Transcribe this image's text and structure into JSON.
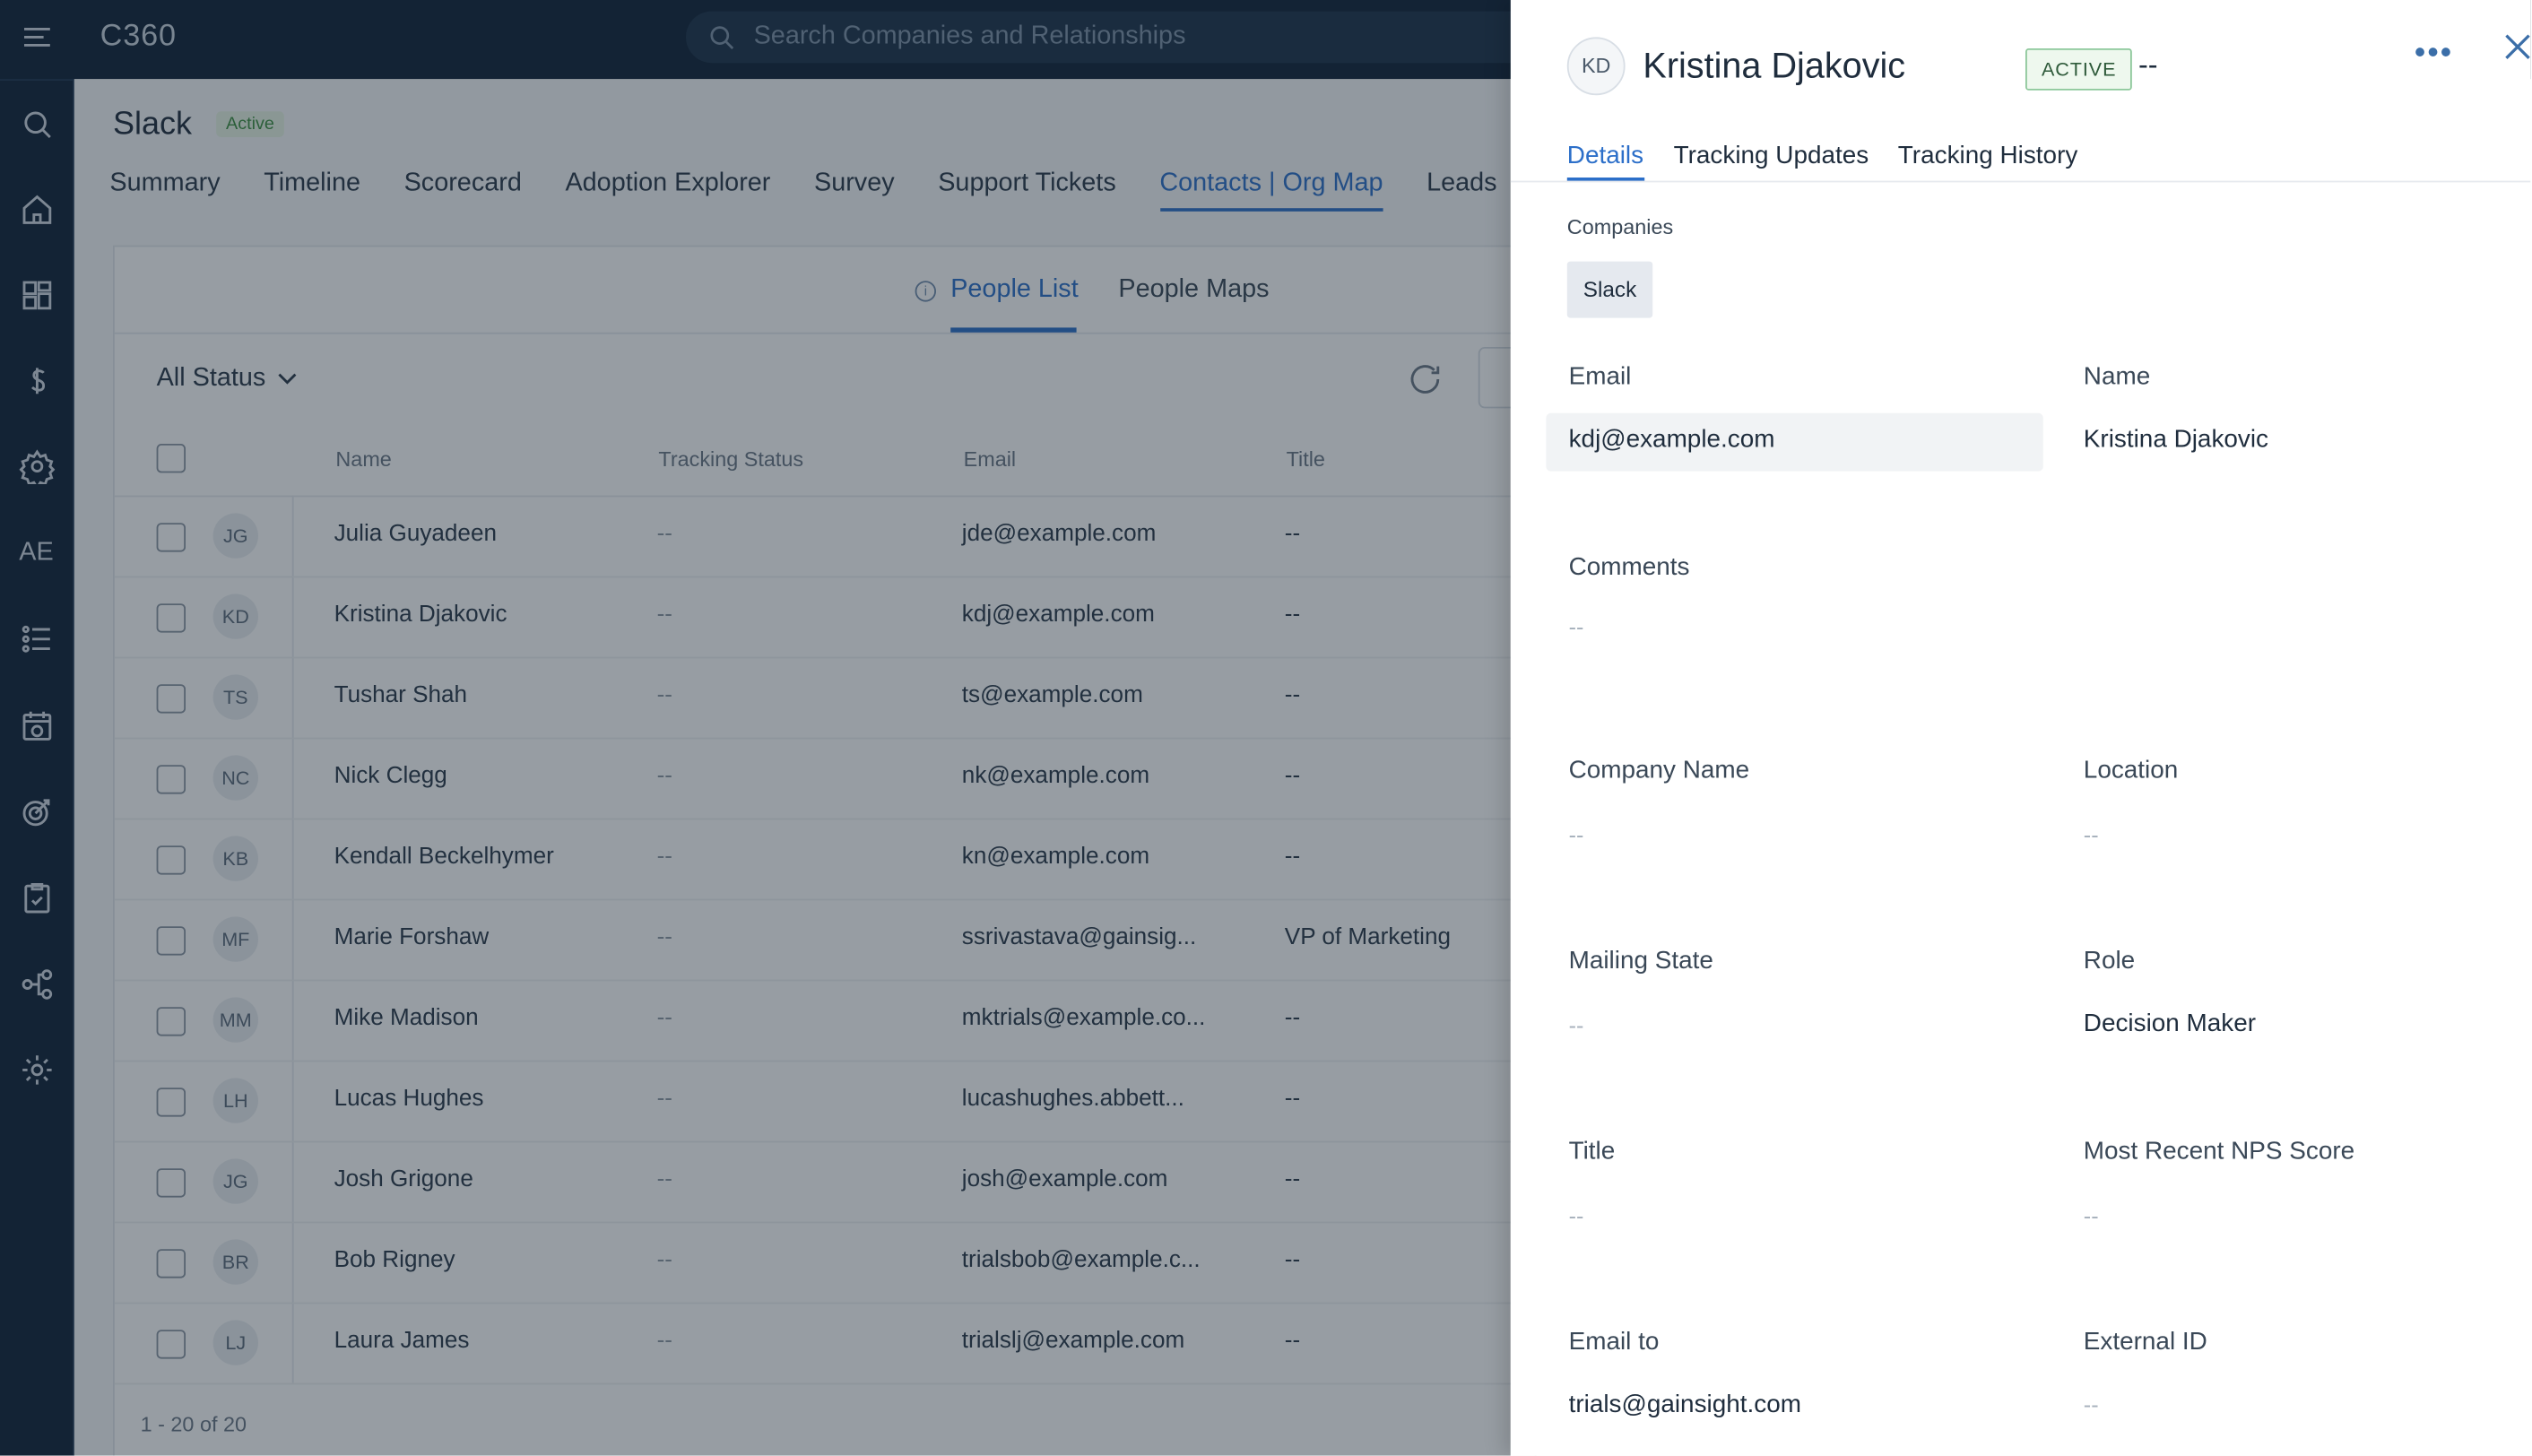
{
  "app": {
    "brand": "C360",
    "search_placeholder": "Search Companies and Relationships"
  },
  "rail": {
    "icons": [
      "menu-icon",
      "search-icon",
      "home-icon",
      "dashboard-icon",
      "dollar-icon",
      "gear-badge-icon",
      "ae-icon",
      "timeline-list-icon",
      "calendar-clock-icon",
      "target-icon",
      "clipboard-check-icon",
      "hierarchy-icon",
      "settings-icon"
    ],
    "ae_label": "AE"
  },
  "account": {
    "name": "Slack",
    "status": "Active"
  },
  "tabs": [
    "Summary",
    "Timeline",
    "Scorecard",
    "Adoption Explorer",
    "Survey",
    "Support Tickets",
    "Contacts | Org Map",
    "Leads"
  ],
  "active_tab": "Contacts | Org Map",
  "subtabs": {
    "people_list": "People List",
    "people_maps": "People Maps"
  },
  "filter": {
    "status": "All Status"
  },
  "table": {
    "headers": {
      "name": "Name",
      "tracking": "Tracking Status",
      "email": "Email",
      "title": "Title"
    },
    "rows": [
      {
        "initials": "JG",
        "name": "Julia Guyadeen",
        "tracking": "--",
        "email": "jde@example.com",
        "title": "--"
      },
      {
        "initials": "KD",
        "name": "Kristina Djakovic",
        "tracking": "--",
        "email": "kdj@example.com",
        "title": "--"
      },
      {
        "initials": "TS",
        "name": "Tushar Shah",
        "tracking": "--",
        "email": "ts@example.com",
        "title": "--"
      },
      {
        "initials": "NC",
        "name": "Nick Clegg",
        "tracking": "--",
        "email": "nk@example.com",
        "title": "--"
      },
      {
        "initials": "KB",
        "name": "Kendall Beckelhymer",
        "tracking": "--",
        "email": "kn@example.com",
        "title": "--"
      },
      {
        "initials": "MF",
        "name": "Marie Forshaw",
        "tracking": "--",
        "email": "ssrivastava@gainsig...",
        "title": "VP of Marketing"
      },
      {
        "initials": "MM",
        "name": "Mike Madison",
        "tracking": "--",
        "email": "mktrials@example.co...",
        "title": "--"
      },
      {
        "initials": "LH",
        "name": "Lucas Hughes",
        "tracking": "--",
        "email": "lucashughes.abbett...",
        "title": "--"
      },
      {
        "initials": "JG",
        "name": "Josh Grigone",
        "tracking": "--",
        "email": "josh@example.com",
        "title": "--"
      },
      {
        "initials": "BR",
        "name": "Bob Rigney",
        "tracking": "--",
        "email": "trialsbob@example.c...",
        "title": "--"
      },
      {
        "initials": "LJ",
        "name": "Laura James",
        "tracking": "--",
        "email": "trialslj@example.com",
        "title": "--"
      }
    ],
    "pager": "1 - 20 of 20"
  },
  "drawer": {
    "initials": "KD",
    "name": "Kristina Djakovic",
    "status": "ACTIVE",
    "status_suffix": "--",
    "more": "•••",
    "tabs": {
      "details": "Details",
      "updates": "Tracking Updates",
      "history": "Tracking History"
    },
    "companies_label": "Companies",
    "company_chip": "Slack",
    "fields": {
      "email_label": "Email",
      "email_value": "kdj@example.com",
      "name_label": "Name",
      "name_value": "Kristina Djakovic",
      "comments_label": "Comments",
      "comments_value": "--",
      "company_name_label": "Company Name",
      "company_name_value": "--",
      "location_label": "Location",
      "location_value": "--",
      "mailing_state_label": "Mailing State",
      "mailing_state_value": "--",
      "role_label": "Role",
      "role_value": "Decision Maker",
      "title_label": "Title",
      "title_value": "--",
      "nps_label": "Most Recent NPS Score",
      "nps_value": "--",
      "email_to_label": "Email to",
      "email_to_value": "trials@gainsight.com",
      "external_id_label": "External ID",
      "external_id_value": "--"
    }
  },
  "colors": {
    "rail": "#0f2238",
    "accent": "#2c6fc9",
    "active_green": "#3c8e41"
  }
}
